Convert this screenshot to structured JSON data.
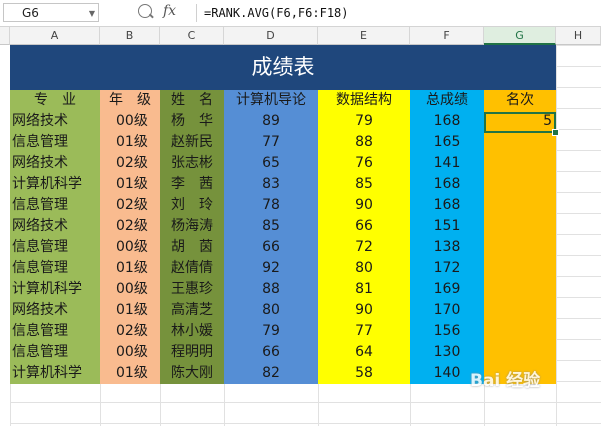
{
  "formula_bar": {
    "name_box": "G6",
    "fx_label": "fx",
    "formula": "=RANK.AVG(F6,F6:F18)"
  },
  "column_headers": [
    "A",
    "B",
    "C",
    "D",
    "E",
    "F",
    "G",
    "H"
  ],
  "selected_column": "G",
  "sheet": {
    "title": "成绩表",
    "headers": [
      "专　业",
      "年　级",
      "姓　名",
      "计算机导论",
      "数据结构",
      "总成绩",
      "名次"
    ],
    "rows": [
      {
        "major": "网络技术",
        "grade": "00级",
        "name": "杨　华",
        "intro": "89",
        "ds": "79",
        "total": "168",
        "rank": "5"
      },
      {
        "major": "信息管理",
        "grade": "01级",
        "name": "赵新民",
        "intro": "77",
        "ds": "88",
        "total": "165",
        "rank": ""
      },
      {
        "major": "网络技术",
        "grade": "02级",
        "name": "张志彬",
        "intro": "65",
        "ds": "76",
        "total": "141",
        "rank": ""
      },
      {
        "major": "计算机科学",
        "grade": "01级",
        "name": "李　茜",
        "intro": "83",
        "ds": "85",
        "total": "168",
        "rank": ""
      },
      {
        "major": "信息管理",
        "grade": "02级",
        "name": "刘　玲",
        "intro": "78",
        "ds": "90",
        "total": "168",
        "rank": ""
      },
      {
        "major": "网络技术",
        "grade": "02级",
        "name": "杨海涛",
        "intro": "85",
        "ds": "66",
        "total": "151",
        "rank": ""
      },
      {
        "major": "信息管理",
        "grade": "00级",
        "name": "胡　茵",
        "intro": "66",
        "ds": "72",
        "total": "138",
        "rank": ""
      },
      {
        "major": "信息管理",
        "grade": "01级",
        "name": "赵倩倩",
        "intro": "92",
        "ds": "80",
        "total": "172",
        "rank": ""
      },
      {
        "major": "计算机科学",
        "grade": "00级",
        "name": "王惠珍",
        "intro": "88",
        "ds": "81",
        "total": "169",
        "rank": ""
      },
      {
        "major": "网络技术",
        "grade": "01级",
        "name": "高清芝",
        "intro": "80",
        "ds": "90",
        "total": "170",
        "rank": ""
      },
      {
        "major": "信息管理",
        "grade": "02级",
        "name": "林小媛",
        "intro": "79",
        "ds": "77",
        "total": "156",
        "rank": ""
      },
      {
        "major": "信息管理",
        "grade": "00级",
        "name": "程明明",
        "intro": "66",
        "ds": "64",
        "total": "130",
        "rank": ""
      },
      {
        "major": "计算机科学",
        "grade": "01级",
        "name": "陈大刚",
        "intro": "82",
        "ds": "58",
        "total": "140",
        "rank": ""
      }
    ]
  },
  "colors": {
    "title_bg": "#1f477c",
    "major": "#9bbb59",
    "grade": "#f9bb8f",
    "name": "#76923c",
    "intro": "#558ed5",
    "ds": "#ffff00",
    "total": "#00b0f0",
    "rank": "#ffc000"
  },
  "watermark": "Bai 经验"
}
